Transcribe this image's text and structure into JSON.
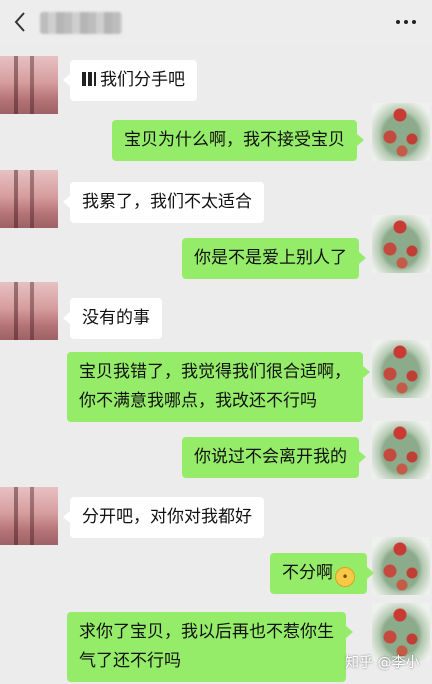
{
  "messages": [
    {
      "side": "left",
      "text": "我们分手吧"
    },
    {
      "side": "right",
      "text": "宝贝为什么啊，我不接受宝贝"
    },
    {
      "side": "left",
      "text": "我累了，我们不太适合"
    },
    {
      "side": "right",
      "text": "你是不是爱上别人了"
    },
    {
      "side": "left",
      "text": "没有的事"
    },
    {
      "side": "right",
      "line1": "宝贝我错了，我觉得我们很合适啊，",
      "line2": "你不满意我哪点，我改还不行吗"
    },
    {
      "side": "right",
      "text": "你说过不会离开我的"
    },
    {
      "side": "left",
      "text": "分开吧，对你对我都好"
    },
    {
      "side": "right",
      "text": "不分啊"
    },
    {
      "side": "right",
      "line1": "求你了宝贝，我以后再也不惹你生",
      "line2": "气了还不行吗"
    }
  ],
  "watermark": "知乎 @李小",
  "icons": {
    "back": "back-arrow-icon",
    "menu": "more-icon",
    "emoji": "crying-emoji-icon"
  }
}
